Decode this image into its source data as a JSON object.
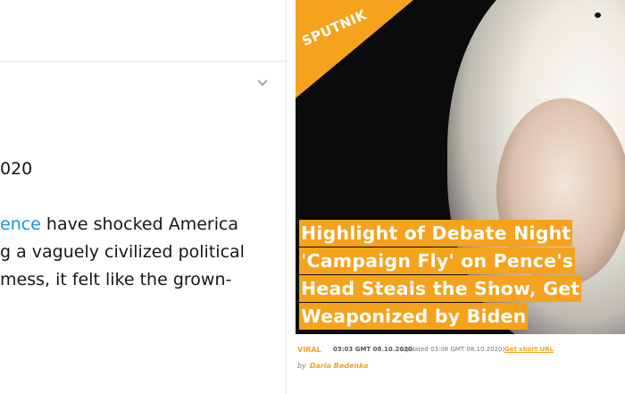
{
  "tweet": {
    "date_partial": "020",
    "text_lines": [
      {
        "prefix": "",
        "mention": "ence",
        "rest": " have shocked America"
      },
      {
        "prefix": "g a vaguely civilized political",
        "mention": "",
        "rest": ""
      },
      {
        "prefix": " mess, it felt like the grown-",
        "mention": "",
        "rest": ""
      }
    ],
    "colors": {
      "text": "#14171a",
      "mention": "#1b95e0"
    },
    "menu_icon": "chevron-down-icon"
  },
  "article": {
    "logo_text": "SPUTNIK",
    "headline_lines": [
      "Highlight of Debate Night",
      "'Campaign Fly' on Pence's",
      "Head Steals the Show, Get",
      "Weaponized by Biden"
    ],
    "meta": {
      "category": "VIRAL",
      "time": "03:03 GMT 08.10.2020",
      "updated": "(updated 03:08 GMT 08.10.2020)",
      "short_url": "Get short URL"
    },
    "byline": {
      "by": "by",
      "author": "Daria Bedenko"
    },
    "colors": {
      "accent": "#f5a21c",
      "hero_bg": "#0b0b0b"
    }
  }
}
